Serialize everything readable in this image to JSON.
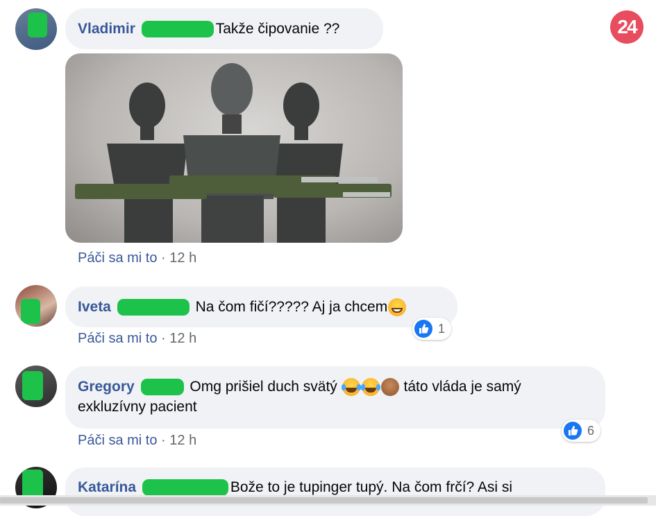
{
  "brand": {
    "logo": "24",
    "color": "#e84c5f"
  },
  "comments": [
    {
      "name": "Vladimir",
      "text": "Takže čipovanie ??",
      "like_label": "Páči sa mi to",
      "time": "· 12 h"
    },
    {
      "name": "Iveta",
      "text": "Na čom fičí????? Aj ja chcem",
      "like_label": "Páči sa mi to",
      "time": "· 12 h",
      "reactions": "1"
    },
    {
      "name": "Gregory",
      "text_1": "Omg prišiel duch svätý",
      "text_2": "táto vláda je samý",
      "text_3": "exkluzívny pacient",
      "like_label": "Páči sa mi to",
      "time": "· 12 h",
      "reactions": "6"
    },
    {
      "name": "Katarína",
      "text": "Bože to je tupinger tupý. Na čom frčí? Asi si"
    }
  ],
  "icons": [
    "thumbs-up-icon",
    "laughing-emoji-icon",
    "see-no-evil-monkey-icon",
    "grinning-emoji-icon"
  ],
  "colors": {
    "name_link": "#385898",
    "bubble": "#f0f2f5",
    "reaction_blue": "#1877f2",
    "redaction": "#1dc24a"
  }
}
